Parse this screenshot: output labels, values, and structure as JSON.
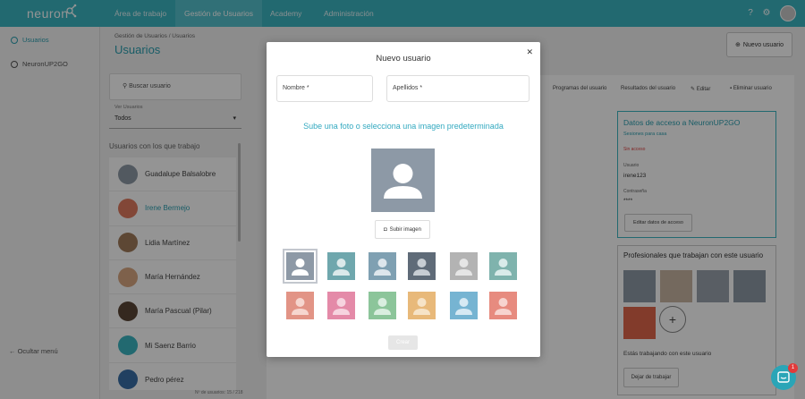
{
  "app": {
    "logo_text": "neuron"
  },
  "topnav": {
    "tabs": [
      {
        "label": "Área de trabajo"
      },
      {
        "label": "Gestión de Usuarios"
      },
      {
        "label": "Academy"
      },
      {
        "label": "Administración"
      }
    ],
    "active_color": "#55c2cd",
    "bar_color": "#3bb5c2"
  },
  "leftnav": {
    "items": [
      {
        "label": "Usuarios"
      },
      {
        "label": "NeuronUP2GO"
      }
    ],
    "hide_label": "Ocultar menú"
  },
  "header": {
    "breadcrumb": "Gestión de Usuarios /  Usuarios",
    "title": "Usuarios",
    "new_user_label": "Nuevo usuario"
  },
  "list": {
    "search_placeholder": "Buscar usuario",
    "filter_label": "Ver Usuarios",
    "filter_value": "Todos",
    "heading": "Usuarios con los que trabajo",
    "users": [
      {
        "name": "Guadalupe Balsalobre"
      },
      {
        "name": "Irene Bermejo"
      },
      {
        "name": "Lidia Martínez"
      },
      {
        "name": "María Hernández"
      },
      {
        "name": "María Pascual (Pilar)"
      },
      {
        "name": "Mi Saenz Barrio"
      },
      {
        "name": "Pedro pérez"
      }
    ],
    "count": "Nº de usuarios: 15 / 218"
  },
  "detail": {
    "tabs": [
      {
        "label": "Programas del usuario"
      },
      {
        "label": "Resultados del usuario"
      },
      {
        "label": "Editar"
      },
      {
        "label": "Eliminar usuario"
      }
    ],
    "access": {
      "title": "Datos de acceso a NeuronUP2GO",
      "subtitle": "Sesiones para casa",
      "status": "Sin acceso",
      "user_label": "Usuario",
      "user_value": "irene123",
      "password_label": "Contraseña",
      "password_value": "****",
      "edit_button": "Editar datos de acceso"
    },
    "professionals": {
      "title": "Profesionales que trabajan con este usuario",
      "note": "Estás trabajando con este usuario",
      "stop_button": "Dejar de trabajar"
    }
  },
  "modal": {
    "title": "Nuevo usuario",
    "name_placeholder": "Nombre *",
    "surname_placeholder": "Apellidos *",
    "upload_prompt": "Sube una foto o selecciona una imagen predeterminada",
    "upload_button": "Subir imagen",
    "create_button": "Crear",
    "presets": [
      {
        "color": "#8d99a6",
        "person": "#ffffff"
      },
      {
        "color": "#6fa7ad",
        "person": "#dbe9ea"
      },
      {
        "color": "#7fa0b2",
        "person": "#dde6ec"
      },
      {
        "color": "#5f6b78",
        "person": "#c7cdd3"
      },
      {
        "color": "#b3b3b3",
        "person": "#e5e5e5"
      },
      {
        "color": "#7fb3ad",
        "person": "#d9ebe9"
      },
      {
        "color": "#e29486",
        "person": "#f6d6cf"
      },
      {
        "color": "#e48aa8",
        "person": "#f6d3df"
      },
      {
        "color": "#8cc59a",
        "person": "#d9eedf"
      },
      {
        "color": "#e8b97a",
        "person": "#f6e3c7"
      },
      {
        "color": "#76b4d2",
        "person": "#d6e9f3"
      },
      {
        "color": "#e78b7f",
        "person": "#f7d4cf"
      }
    ]
  },
  "chat": {
    "badge": "1"
  }
}
